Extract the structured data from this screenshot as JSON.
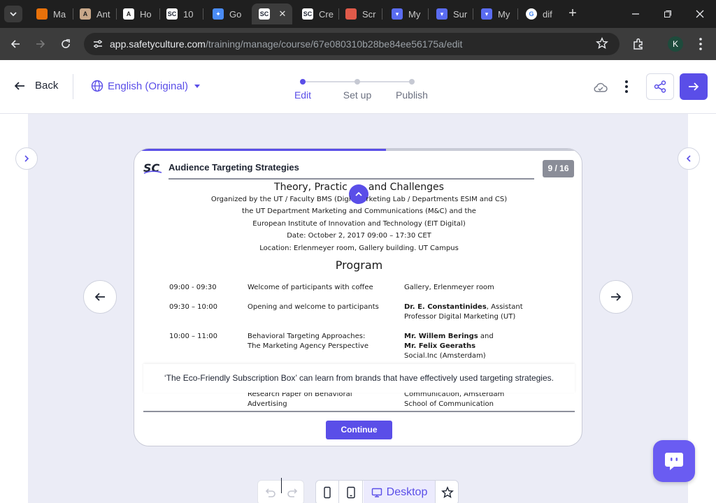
{
  "browser": {
    "tabs": [
      {
        "label": "Ma",
        "icon": "orange-app-icon",
        "color": "#e8710a"
      },
      {
        "label": "Ant",
        "icon": "anthropic-icon",
        "color": "#c9a88a"
      },
      {
        "label": "Ho",
        "icon": "anthropic-icon",
        "color": "#ffffff"
      },
      {
        "label": "10",
        "icon": "safetyculture-icon",
        "color": "#ffffff"
      },
      {
        "label": "Go",
        "icon": "butterfly-icon",
        "color": "#4a8cf7"
      },
      {
        "label": "",
        "icon": "safetyculture-icon",
        "color": "#ffffff"
      },
      {
        "label": "Cre",
        "icon": "safetyculture-icon",
        "color": "#ffffff"
      },
      {
        "label": "Scr",
        "icon": "image-icon",
        "color": "#e05a4a"
      },
      {
        "label": "My",
        "icon": "chat-icon",
        "color": "#5a6cf2"
      },
      {
        "label": "Sur",
        "icon": "chat-icon",
        "color": "#5a6cf2"
      },
      {
        "label": "My",
        "icon": "chat-icon",
        "color": "#5a6cf2"
      },
      {
        "label": "dif",
        "icon": "google-icon",
        "color": "#ffffff"
      }
    ],
    "url_host": "app.safetyculture.com",
    "url_path": "/training/manage/course/67e080310b28be84ee56175a/edit",
    "profile_initial": "K"
  },
  "header": {
    "back_label": "Back",
    "language_label": "English (Original)",
    "steps": [
      {
        "label": "Edit",
        "active": true
      },
      {
        "label": "Set up",
        "active": false
      },
      {
        "label": "Publish",
        "active": false
      }
    ],
    "accent_color": "#5a4ee8"
  },
  "slide": {
    "progress": 0.56,
    "logo_text": "SC",
    "course_title": "Audience Targeting Strategies",
    "page_indicator": "9 / 16",
    "doc": {
      "heading_left": "Theory, Practic",
      "heading_right": "and Challenges",
      "line1_left": "Organized by the UT / Faculty BMS (Digi",
      "line1_right": "rketing Lab / Departments ESIM and CS)",
      "line2": "the UT Department Marketing and Communications (M&C) and the",
      "line3": "European Institute of Innovation and Technology (EIT Digital)",
      "line4": "Date: October 2, 2017 09:00 – 17:30 CET",
      "line5": "Location: Erlenmeyer room, Gallery building. UT Campus",
      "program_title": "Program",
      "program": [
        {
          "time": "09:00 - 09:30",
          "session": "Welcome of participants with coffee",
          "who_bold": "",
          "who": "Gallery, Erlenmeyer room"
        },
        {
          "time": "09:30 – 10:00",
          "session": "Opening and welcome to participants",
          "who_bold": "Dr. E. Constantinides",
          "who": ", Assistant",
          "who_extra": "Professor Digital Marketing (UT)"
        },
        {
          "time": "10:00 – 11:00",
          "session": "Behavioral Targeting Approaches:",
          "session2": "The Marketing Agency Perspective",
          "who_bold": "Mr. Willem Berings",
          "who": " and",
          "who_bold2": "Mr. Felix Geeraths",
          "who_extra": "Social.Inc (Amsterdam)"
        }
      ],
      "cut_left1": "Research Paper on Behavioral",
      "cut_left2": "Advertising",
      "cut_right1": "Communication, Amsterdam",
      "cut_right2": "School of Communication"
    },
    "caption": "‘The Eco-Friendly Subscription Box’ can learn from brands that have effectively used targeting strategies.",
    "continue_label": "Continue"
  },
  "toolbar": {
    "desktop_label": "Desktop"
  }
}
